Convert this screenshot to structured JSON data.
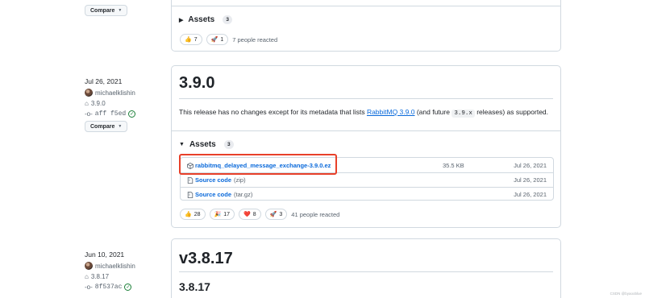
{
  "top_release": {
    "compare_label": "Compare",
    "assets_label": "Assets",
    "assets_count": "3",
    "reactions": [
      {
        "emoji": "👍",
        "count": "7"
      },
      {
        "emoji": "🚀",
        "count": "1"
      }
    ],
    "reacted_text": "7 people reacted"
  },
  "release_390": {
    "date": "Jul 26, 2021",
    "author": "michaelklishin",
    "tag": "3.9.0",
    "commit": "aff f5ed",
    "compare_label": "Compare",
    "title": "3.9.0",
    "desc_before": "This release has no changes except for its metadata that lists ",
    "desc_link": "RabbitMQ 3.9.0",
    "desc_middle": " (and future ",
    "desc_code": "3.9.x",
    "desc_after": " releases) as supported.",
    "assets_label": "Assets",
    "assets_count": "3",
    "assets": [
      {
        "name": "rabbitmq_delayed_message_exchange-3.9.0.ez",
        "extra": "",
        "size": "35.5 KB",
        "date": "Jul 26, 2021",
        "icon": "package-icon"
      },
      {
        "name": "Source code",
        "extra": "(zip)",
        "size": "",
        "date": "Jul 26, 2021",
        "icon": "file-zip-icon"
      },
      {
        "name": "Source code",
        "extra": "(tar.gz)",
        "size": "",
        "date": "Jul 26, 2021",
        "icon": "file-zip-icon"
      }
    ],
    "reactions": [
      {
        "emoji": "👍",
        "count": "28"
      },
      {
        "emoji": "🎉",
        "count": "17"
      },
      {
        "emoji": "❤️",
        "count": "8"
      },
      {
        "emoji": "🚀",
        "count": "3"
      }
    ],
    "reacted_text": "41 people reacted"
  },
  "release_3817": {
    "date": "Jun 10, 2021",
    "author": "michaelklishin",
    "tag": "3.8.17",
    "commit": "8f537ac",
    "title": "v3.8.17",
    "subtitle": "3.8.17"
  },
  "watermark": "CSDN @byaooblue",
  "colors": {
    "link": "#0969da",
    "highlight": "#e8402a",
    "verified": "#1a7f37"
  }
}
